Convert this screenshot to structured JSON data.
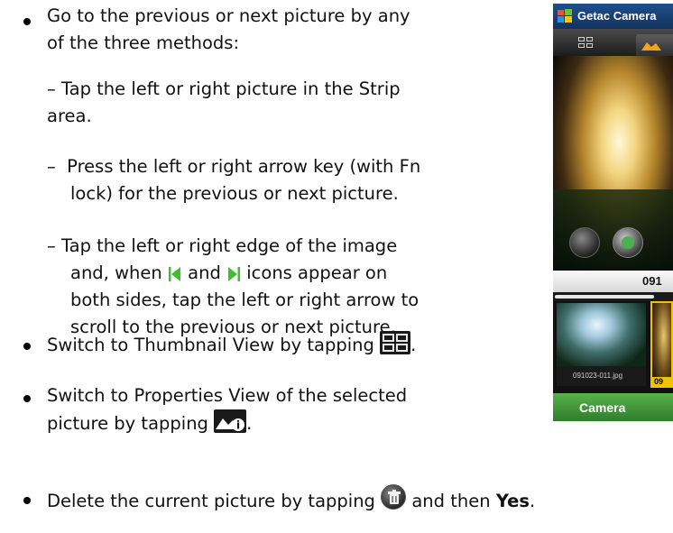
{
  "bullets": [
    {
      "line1": "Go to the previous or next picture by any",
      "line2": "of the three methods:"
    },
    {
      "text": "Switch to Thumbnail View by tapping"
    },
    {
      "line1": "Switch to Properties View of the selected",
      "line2": "picture by tapping"
    },
    {
      "before": "Delete the current picture by tapping",
      "after": "and then",
      "bold": "Yes"
    }
  ],
  "methods": [
    {
      "dash": "–",
      "line1": "Tap the left or right picture in the Strip",
      "line2": "area."
    },
    {
      "dash": "–",
      "line1": "Press the left or right arrow key (with Fn",
      "line2": "lock) for the previous or next picture."
    },
    {
      "dash": "–",
      "line1": "Tap the left or right edge of the image",
      "line2a": "and, when",
      "line2b": "and",
      "line2c": "icons appear on",
      "line3": "both sides, tap the left or right arrow to",
      "line4": "scroll to the previous or next picture."
    }
  ],
  "punct": {
    "period": "."
  },
  "device": {
    "title": "Getac Camera",
    "filename_visible": "091",
    "thumb_caption": "091023-011.jpg",
    "thumb2_caption": "09",
    "softkey_left": "Camera",
    "progress": 0.85,
    "colors": {
      "titlebar": "#1f4f8a",
      "softkeys": "#3f9637",
      "highlight": "#f2c200",
      "green_arrow": "#3fbf2f"
    }
  },
  "icons": {
    "bullet": "bullet-icon",
    "thumbnail": "thumbnail-view-icon",
    "properties": "properties-view-icon",
    "delete": "delete-icon",
    "prev": "previous-arrow-icon",
    "next": "next-arrow-icon"
  }
}
